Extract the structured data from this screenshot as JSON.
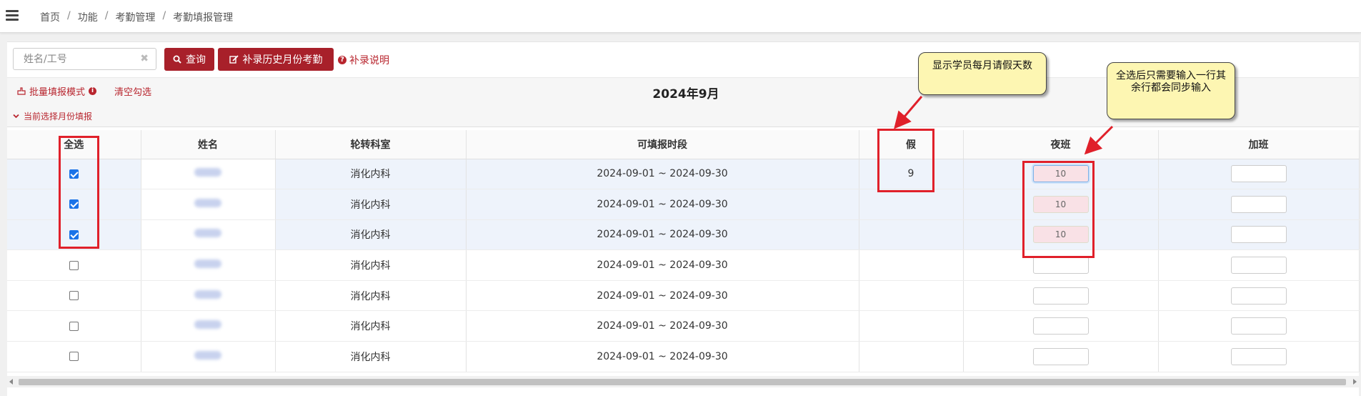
{
  "breadcrumb": [
    "首页",
    "功能",
    "考勤管理",
    "考勤填报管理"
  ],
  "search": {
    "placeholder": "姓名/工号",
    "value": ""
  },
  "buttons": {
    "query": "查询",
    "history": "补录历史月份考勤",
    "help": "补录说明",
    "batch_mode": "批量填报模式",
    "clear_selection": "清空勾选"
  },
  "month_title": "2024年9月",
  "month_toggle": "当前选择月份填报",
  "table": {
    "headers": [
      "全选",
      "姓名",
      "轮转科室",
      "可填报时段",
      "假",
      "夜班",
      "加班"
    ],
    "rows": [
      {
        "checked": true,
        "dept": "消化内科",
        "period": "2024-09-01 ~ 2024-09-30",
        "leave": "9",
        "night": "10",
        "overtime": ""
      },
      {
        "checked": true,
        "dept": "消化内科",
        "period": "2024-09-01 ~ 2024-09-30",
        "leave": "",
        "night": "10",
        "overtime": ""
      },
      {
        "checked": true,
        "dept": "消化内科",
        "period": "2024-09-01 ~ 2024-09-30",
        "leave": "",
        "night": "10",
        "overtime": ""
      },
      {
        "checked": false,
        "dept": "消化内科",
        "period": "2024-09-01 ~ 2024-09-30",
        "leave": "",
        "night": "",
        "overtime": ""
      },
      {
        "checked": false,
        "dept": "消化内科",
        "period": "2024-09-01 ~ 2024-09-30",
        "leave": "",
        "night": "",
        "overtime": ""
      },
      {
        "checked": false,
        "dept": "消化内科",
        "period": "2024-09-01 ~ 2024-09-30",
        "leave": "",
        "night": "",
        "overtime": ""
      },
      {
        "checked": false,
        "dept": "消化内科",
        "period": "2024-09-01 ~ 2024-09-30",
        "leave": "",
        "night": "",
        "overtime": ""
      }
    ]
  },
  "annotations": {
    "leave_note": "显示学员每月请假天数",
    "sync_note": "全选后只需要输入一行其余行都会同步输入"
  },
  "colors": {
    "accent": "#a8202a",
    "link": "#b8252e",
    "annotation_red": "#e0202a",
    "callout_bg": "#fdf6b2"
  }
}
